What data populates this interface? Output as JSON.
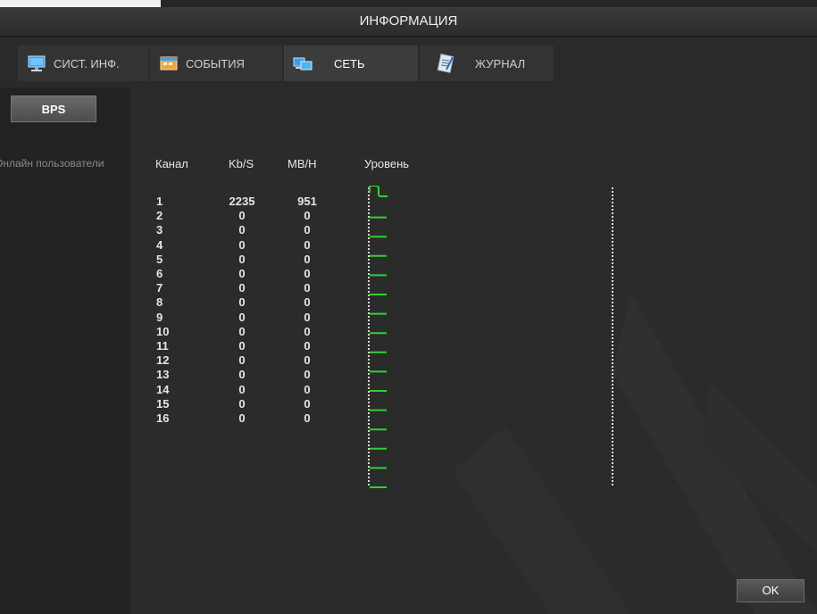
{
  "window": {
    "title": "ИНФОРМАЦИЯ"
  },
  "tabs": [
    {
      "label": "СИСТ. ИНФ.",
      "icon": "monitor-icon"
    },
    {
      "label": "СОБЫТИЯ",
      "icon": "events-icon"
    },
    {
      "label": "СЕТЬ",
      "icon": "network-icon",
      "active": true
    },
    {
      "label": "ЖУРНАЛ",
      "icon": "log-icon"
    }
  ],
  "sidebar": {
    "bps_button": "BPS",
    "online_users": "Онлайн пользователи"
  },
  "table": {
    "headers": {
      "channel": "Канал",
      "kbs": "Kb/S",
      "mbh": "MB/H",
      "level": "Уровень"
    },
    "rows": [
      {
        "channel": "1",
        "kbs": "2235",
        "mbh": "951"
      },
      {
        "channel": "2",
        "kbs": "0",
        "mbh": "0"
      },
      {
        "channel": "3",
        "kbs": "0",
        "mbh": "0"
      },
      {
        "channel": "4",
        "kbs": "0",
        "mbh": "0"
      },
      {
        "channel": "5",
        "kbs": "0",
        "mbh": "0"
      },
      {
        "channel": "6",
        "kbs": "0",
        "mbh": "0"
      },
      {
        "channel": "7",
        "kbs": "0",
        "mbh": "0"
      },
      {
        "channel": "8",
        "kbs": "0",
        "mbh": "0"
      },
      {
        "channel": "9",
        "kbs": "0",
        "mbh": "0"
      },
      {
        "channel": "10",
        "kbs": "0",
        "mbh": "0"
      },
      {
        "channel": "11",
        "kbs": "0",
        "mbh": "0"
      },
      {
        "channel": "12",
        "kbs": "0",
        "mbh": "0"
      },
      {
        "channel": "13",
        "kbs": "0",
        "mbh": "0"
      },
      {
        "channel": "14",
        "kbs": "0",
        "mbh": "0"
      },
      {
        "channel": "15",
        "kbs": "0",
        "mbh": "0"
      },
      {
        "channel": "16",
        "kbs": "0",
        "mbh": "0"
      }
    ]
  },
  "footer": {
    "ok_label": "OK"
  },
  "colors": {
    "level_line": "#2fd32f",
    "background": "#262626",
    "active_tab": "#3c3c3c"
  }
}
